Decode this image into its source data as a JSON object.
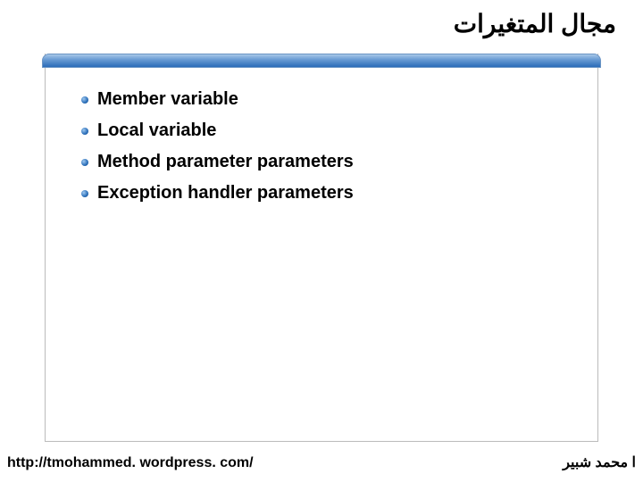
{
  "title": "مجال المتغيرات",
  "items": [
    "Member variable",
    "Local variable",
    "Method parameter parameters",
    "Exception handler parameters"
  ],
  "footer": {
    "url": "http://tmohammed. wordpress. com/",
    "author": "ا محمد شبير"
  }
}
